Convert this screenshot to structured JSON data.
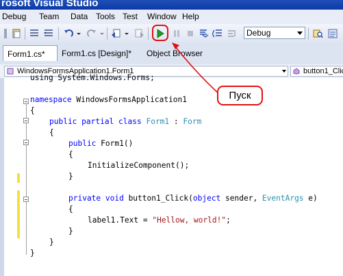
{
  "window": {
    "title": "rosoft Visual Studio"
  },
  "menu": [
    "Debug",
    "Team",
    "Data",
    "Tools",
    "Test",
    "Window",
    "Help"
  ],
  "toolbar": {
    "config_value": "Debug"
  },
  "tabs": [
    {
      "label": "Form1.cs*",
      "active": true
    },
    {
      "label": "Form1.cs [Design]*",
      "active": false
    },
    {
      "label": "Object Browser",
      "active": false
    }
  ],
  "nav": {
    "type_combo": "WindowsFormsApplication1.Form1",
    "member_combo": "button1_Clic"
  },
  "code": {
    "line0": "using System.Windows.Forms;",
    "namespace_kw": "namespace",
    "namespace_name": " WindowsFormsApplication1",
    "brace_open": "{",
    "brace_close": "}",
    "class_kw": "public partial class",
    "class_name": "Form1",
    "colon": " : ",
    "base_class": "Form",
    "ctor_kw": "public",
    "ctor_name": " Form1()",
    "init_call": "InitializeComponent();",
    "method_kw": "private void",
    "method_name": " button1_Click(",
    "param1_kw": "object",
    "param1_name": " sender, ",
    "param2_type": "EventArgs",
    "param2_name": " e)",
    "assign_lhs": "label1.Text = ",
    "assign_str": "\"Hellow, world!\"",
    "semicolon": ";"
  },
  "annotation": {
    "label": "Пуск"
  },
  "colors": {
    "keyword": "#0000ff",
    "type": "#2b91af",
    "string": "#a31515",
    "annotation": "#e01010",
    "change_bar": "#f3e03a"
  }
}
